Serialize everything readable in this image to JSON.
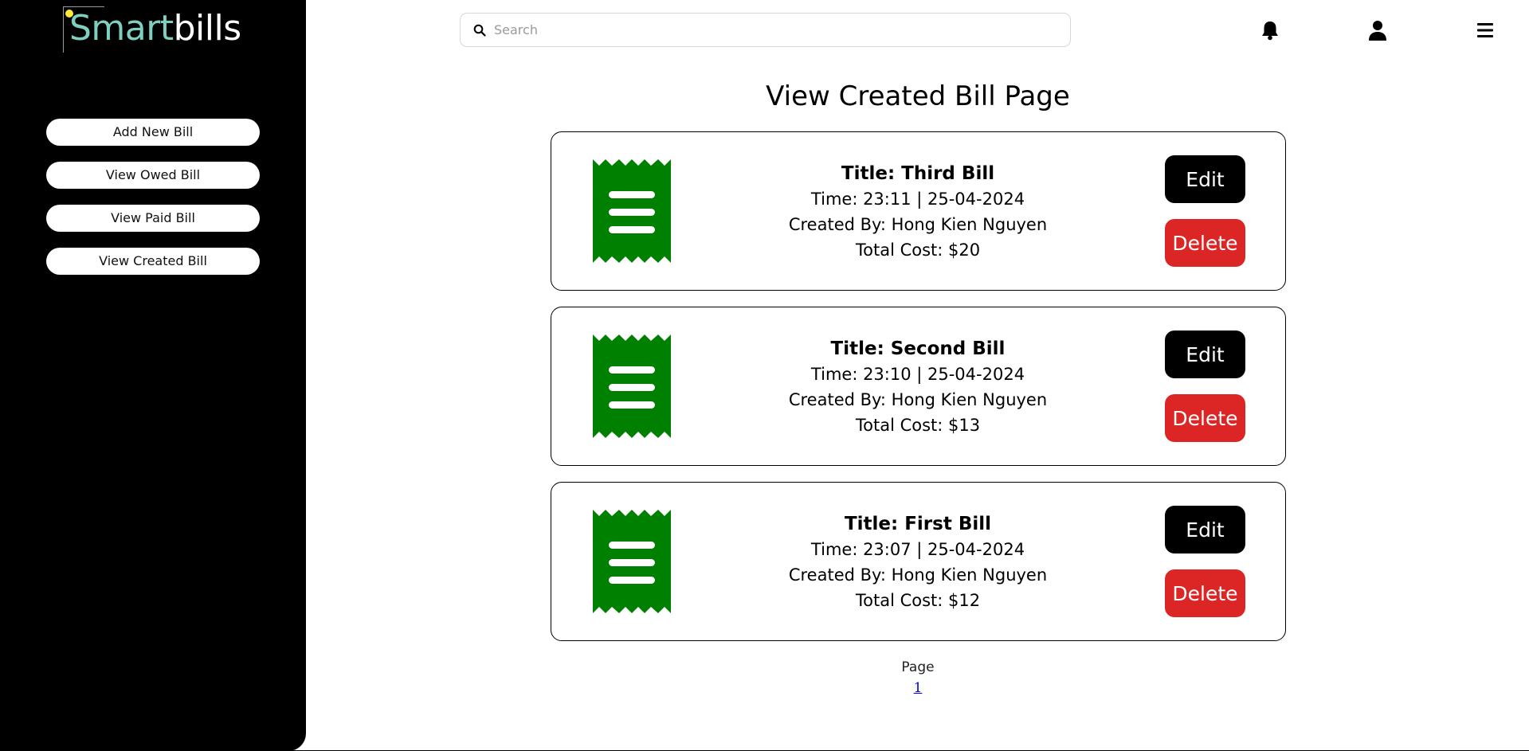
{
  "brand": {
    "part1": "Smart",
    "part2": "bills"
  },
  "sidebar": {
    "items": [
      {
        "label": "Add New Bill"
      },
      {
        "label": "View Owed Bill"
      },
      {
        "label": "View Paid Bill"
      },
      {
        "label": "View Created Bill"
      }
    ]
  },
  "search": {
    "placeholder": "Search",
    "value": ""
  },
  "header_icons": [
    "bell-icon",
    "user-icon",
    "menu-icon"
  ],
  "page": {
    "title": "View Created Bill Page"
  },
  "bills": [
    {
      "title": "Title: Third Bill",
      "time": "Time: 23:11 | 25-04-2024",
      "created_by": "Created By: Hong Kien Nguyen",
      "total": "Total Cost: $20",
      "edit_label": "Edit",
      "delete_label": "Delete"
    },
    {
      "title": "Title: Second Bill",
      "time": "Time: 23:10 | 25-04-2024",
      "created_by": "Created By: Hong Kien Nguyen",
      "total": "Total Cost: $13",
      "edit_label": "Edit",
      "delete_label": "Delete"
    },
    {
      "title": "Title: First Bill",
      "time": "Time: 23:07 | 25-04-2024",
      "created_by": "Created By: Hong Kien Nguyen",
      "total": "Total Cost: $12",
      "edit_label": "Edit",
      "delete_label": "Delete"
    }
  ],
  "pagination": {
    "label": "Page",
    "pages": [
      "1"
    ]
  },
  "colors": {
    "sidebar_bg": "#000000",
    "receipt_icon": "#008000",
    "edit_button": "#000000",
    "delete_button": "#dc2626",
    "brand_accent": "#7ecfc0",
    "logo_dot": "#ffeb3b"
  }
}
